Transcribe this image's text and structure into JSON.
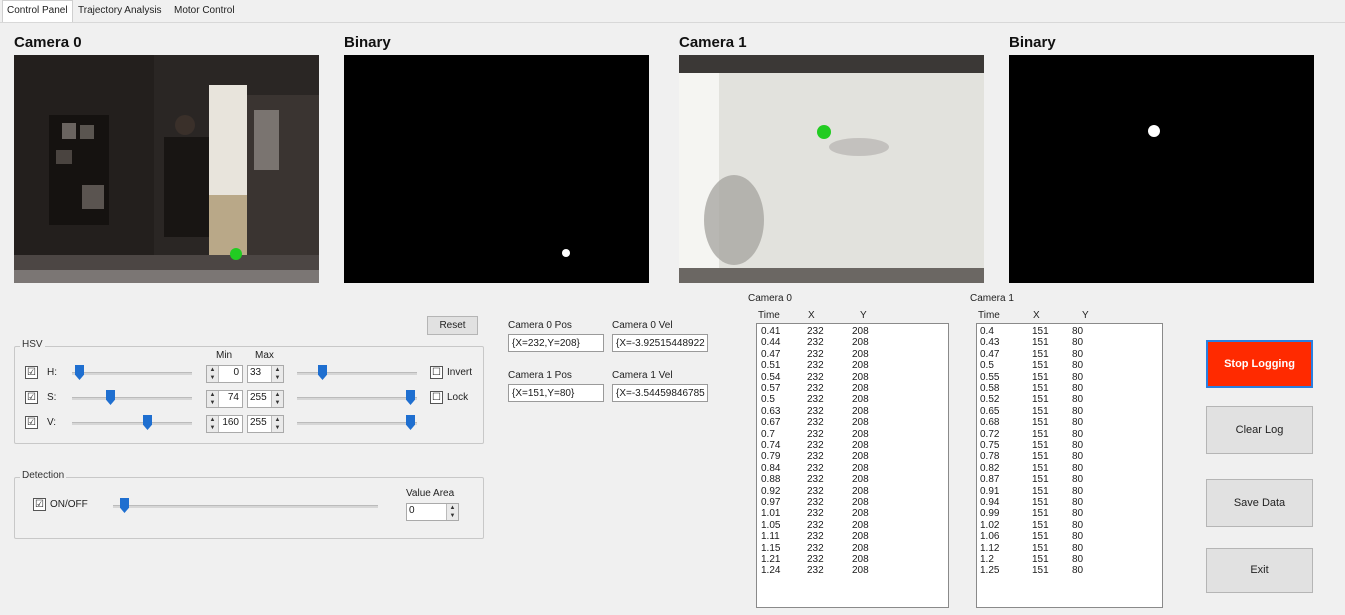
{
  "tabs": [
    "Control Panel",
    "Trajectory Analysis",
    "Motor Control"
  ],
  "cameras": {
    "cam0_title": "Camera 0",
    "bin0_title": "Binary",
    "cam1_title": "Camera 1",
    "bin1_title": "Binary"
  },
  "hsv": {
    "group_label": "HSV",
    "min_label": "Min",
    "max_label": "Max",
    "reset_label": "Reset",
    "invert_label": "Invert",
    "lock_label": "Lock",
    "rows": [
      {
        "label": "H:",
        "checked": "☑",
        "min": "0",
        "max": "33"
      },
      {
        "label": "S:",
        "checked": "☑",
        "min": "74",
        "max": "255"
      },
      {
        "label": "V:",
        "checked": "☑",
        "min": "160",
        "max": "255"
      }
    ],
    "invert_checked": "☐",
    "lock_checked": "☐"
  },
  "detection": {
    "group_label": "Detection",
    "onoff_label": "ON/OFF",
    "onoff_checked": "☑",
    "value_area_label": "Value Area",
    "value_area": "0"
  },
  "positions": {
    "cam0_pos_label": "Camera 0 Pos",
    "cam0_pos": "{X=232,Y=208}",
    "cam0_vel_label": "Camera 0 Vel",
    "cam0_vel": "{X=-3.92515448922",
    "cam1_pos_label": "Camera 1 Pos",
    "cam1_pos": "{X=151,Y=80}",
    "cam1_vel_label": "Camera 1 Vel",
    "cam1_vel": "{X=-3.54459846785"
  },
  "log0": {
    "label": "Camera 0",
    "headers": [
      "Time",
      "X",
      "Y"
    ],
    "rows": [
      [
        "0.41",
        "232",
        "208"
      ],
      [
        "0.44",
        "232",
        "208"
      ],
      [
        "0.47",
        "232",
        "208"
      ],
      [
        "0.51",
        "232",
        "208"
      ],
      [
        "0.54",
        "232",
        "208"
      ],
      [
        "0.57",
        "232",
        "208"
      ],
      [
        "0.5",
        "232",
        "208"
      ],
      [
        "0.63",
        "232",
        "208"
      ],
      [
        "0.67",
        "232",
        "208"
      ],
      [
        "0.7",
        "232",
        "208"
      ],
      [
        "0.74",
        "232",
        "208"
      ],
      [
        "0.79",
        "232",
        "208"
      ],
      [
        "0.84",
        "232",
        "208"
      ],
      [
        "0.88",
        "232",
        "208"
      ],
      [
        "0.92",
        "232",
        "208"
      ],
      [
        "0.97",
        "232",
        "208"
      ],
      [
        "1.01",
        "232",
        "208"
      ],
      [
        "1.05",
        "232",
        "208"
      ],
      [
        "1.11",
        "232",
        "208"
      ],
      [
        "1.15",
        "232",
        "208"
      ],
      [
        "1.21",
        "232",
        "208"
      ],
      [
        "1.24",
        "232",
        "208"
      ]
    ]
  },
  "log1": {
    "label": "Camera 1",
    "headers": [
      "Time",
      "X",
      "Y"
    ],
    "rows": [
      [
        "0.4",
        "151",
        "80"
      ],
      [
        "0.43",
        "151",
        "80"
      ],
      [
        "0.47",
        "151",
        "80"
      ],
      [
        "0.5",
        "151",
        "80"
      ],
      [
        "0.55",
        "151",
        "80"
      ],
      [
        "0.58",
        "151",
        "80"
      ],
      [
        "0.52",
        "151",
        "80"
      ],
      [
        "0.65",
        "151",
        "80"
      ],
      [
        "0.68",
        "151",
        "80"
      ],
      [
        "0.72",
        "151",
        "80"
      ],
      [
        "0.75",
        "151",
        "80"
      ],
      [
        "0.78",
        "151",
        "80"
      ],
      [
        "0.82",
        "151",
        "80"
      ],
      [
        "0.87",
        "151",
        "80"
      ],
      [
        "0.91",
        "151",
        "80"
      ],
      [
        "0.94",
        "151",
        "80"
      ],
      [
        "0.99",
        "151",
        "80"
      ],
      [
        "1.02",
        "151",
        "80"
      ],
      [
        "1.06",
        "151",
        "80"
      ],
      [
        "1.12",
        "151",
        "80"
      ],
      [
        "1.2",
        "151",
        "80"
      ],
      [
        "1.25",
        "151",
        "80"
      ]
    ]
  },
  "actions": {
    "stop_logging": "Stop Logging",
    "clear_log": "Clear Log",
    "save_data": "Save Data",
    "exit": "Exit"
  },
  "colors": {
    "stop_button": "#ff2a00",
    "tracked_point": "#22cc22",
    "slider_thumb": "#1f6fd0"
  }
}
